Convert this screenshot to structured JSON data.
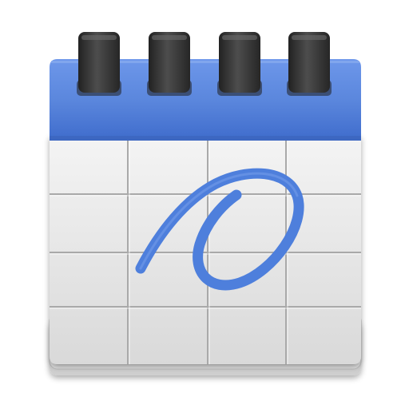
{
  "icon": {
    "kind": "calendar-app-icon",
    "colors": {
      "header_blue": "#5b87dd",
      "header_blue_dark": "#3f6ccc",
      "page_light": "#f1f1f1",
      "page_shade": "#dcdcdc",
      "grid_line": "#a9a9a9",
      "ring_dark": "#2e2e2e",
      "ring_mid": "#4a4a4a",
      "stroke_blue": "#4e7fdc"
    },
    "grid": {
      "columns": 4,
      "rows": 4
    },
    "binder_ring_count": 4,
    "mark": "handwritten-loop-stroke"
  }
}
